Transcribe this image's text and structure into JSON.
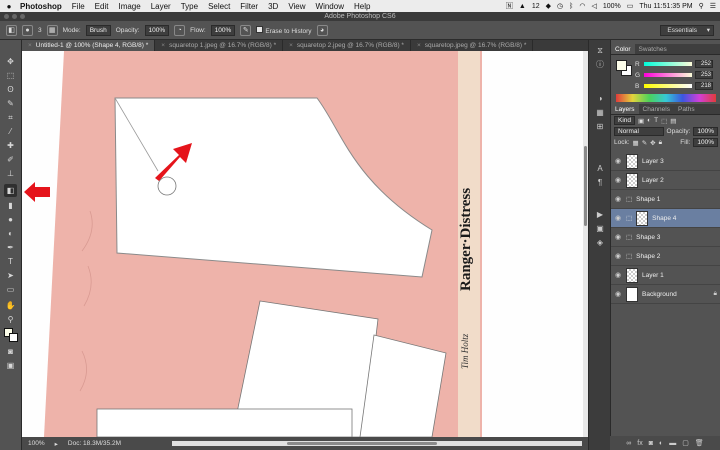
{
  "menubar": {
    "apple": "",
    "app": "Photoshop",
    "items": [
      "File",
      "Edit",
      "Image",
      "Layer",
      "Type",
      "Select",
      "Filter",
      "3D",
      "View",
      "Window",
      "Help"
    ],
    "status_num": "12",
    "battery": "100%",
    "clock": "Thu 11:51:35 PM"
  },
  "window": {
    "title": "Adobe Photoshop CS6"
  },
  "options": {
    "brush_size": "3",
    "mode_label": "Mode:",
    "mode_value": "Brush",
    "opacity_label": "Opacity:",
    "opacity_value": "100%",
    "flow_label": "Flow:",
    "flow_value": "100%",
    "erase_history": "Erase to History",
    "workspace": "Essentials"
  },
  "tabs": [
    {
      "label": "Untitled-1 @ 100% (Shape 4, RGB/8) *"
    },
    {
      "label": "squaretop 1.jpeg @ 16.7% (RGB/8) *"
    },
    {
      "label": "squaretop 2.jpeg @ 16.7% (RGB/8) *"
    },
    {
      "label": "squaretop.jpeg @ 16.7% (RGB/8) *"
    }
  ],
  "status": {
    "zoom": "100%",
    "doc": "Doc: 18.3M/35.2M"
  },
  "canvas": {
    "vertical_text": "Ranger·Distress"
  },
  "color_panel": {
    "tabs": [
      "Color",
      "Swatches"
    ],
    "fg": "#fcfde9",
    "channels": [
      {
        "label": "R",
        "value": "252"
      },
      {
        "label": "G",
        "value": "253"
      },
      {
        "label": "B",
        "value": "218"
      }
    ]
  },
  "layers_panel": {
    "tabs": [
      "Layers",
      "Channels",
      "Paths"
    ],
    "kind": "Kind",
    "blend": "Normal",
    "opacity_label": "Opacity:",
    "opacity": "100%",
    "lock_label": "Lock:",
    "fill_label": "Fill:",
    "fill": "100%",
    "layers": [
      {
        "name": "Layer 3",
        "type": "pixel",
        "selected": false
      },
      {
        "name": "Layer 2",
        "type": "pixel",
        "selected": false
      },
      {
        "name": "Shape 1",
        "type": "shape",
        "selected": false
      },
      {
        "name": "Shape 4",
        "type": "shape",
        "selected": true
      },
      {
        "name": "Shape 3",
        "type": "shape",
        "selected": false
      },
      {
        "name": "Shape 2",
        "type": "shape",
        "selected": false
      },
      {
        "name": "Layer 1",
        "type": "pixel",
        "selected": false
      },
      {
        "name": "Background",
        "type": "background",
        "selected": false
      }
    ]
  },
  "colors": {
    "accent_selected_layer": "#6a7fa1",
    "annotation_arrow": "#e5141b",
    "paper": "#eeb3aa"
  }
}
